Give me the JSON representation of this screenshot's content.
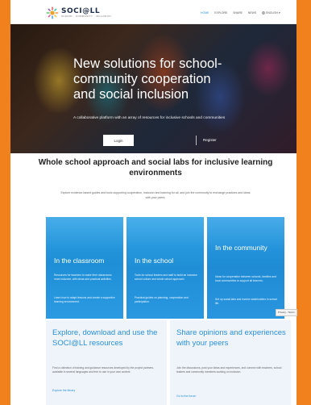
{
  "brand": {
    "name": "SOCI@LL",
    "tagline": "SCHOOL · COMMUNITY · INCLUSION",
    "accent": "#2a8fd9",
    "frame": "#f0811c"
  },
  "nav": {
    "items": [
      "HOME",
      "EXPLORE",
      "SHARE",
      "NEWS"
    ],
    "active": "HOME",
    "language": "ENGLISH"
  },
  "hero": {
    "title": "New solutions for school-community cooperation and social inclusion",
    "subtitle": "A collaborative platform with an array of resources for inclusive schools and communities",
    "login_label": "Login",
    "register_label": "Register"
  },
  "section": {
    "title": "Whole school approach and social labs for inclusive learning environments",
    "description": "Explore evidence-based guides and tools supporting cooperation, inclusion and learning for all, and join the community to exchange practices and ideas with your peers."
  },
  "cards": [
    {
      "title": "In the classroom",
      "text1": "Resources for teachers to make their classrooms more inclusive, with ideas and practical activities.",
      "text2": "Learn how to adapt lessons and create a supportive learning environment."
    },
    {
      "title": "In the school",
      "text1": "Tools for school leaders and staff to build an inclusive school culture and whole school approach.",
      "text2": "Practical guides on planning, cooperation and participation."
    },
    {
      "title": "In the community",
      "text1": "Ideas for cooperation between schools, families and local communities to support all learners.",
      "text2": "Set up social labs and involve stakeholders in school life."
    }
  ],
  "privacy_label": "Privacy - Terms",
  "panels": [
    {
      "title": "Explore, download and use the SOCI@LL resources",
      "text": "Find a collection of training and guidance resources developed by the project partners, available in several languages and free to use in your own context.",
      "link": "Explore the library"
    },
    {
      "title": "Share opinions and experiences with your peers",
      "text": "Join the discussions, post your ideas and experiences, and connect with teachers, school leaders and community members working on inclusion.",
      "link": "Go to the forum"
    }
  ]
}
